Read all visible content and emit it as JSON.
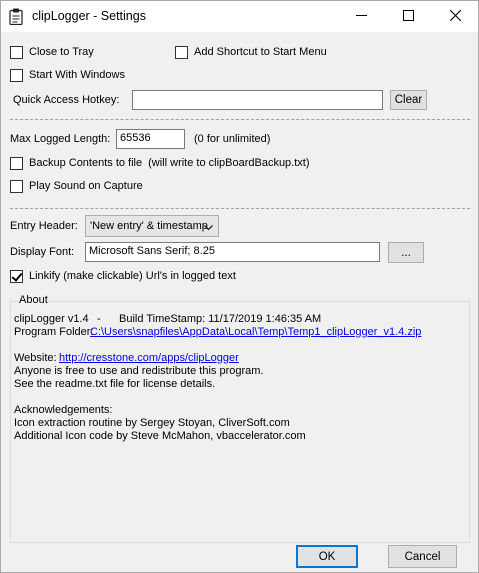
{
  "window": {
    "title": "clipLogger - Settings",
    "icons": [
      "clipboard-icon",
      "minimize-icon",
      "maximize-icon",
      "close-icon"
    ]
  },
  "options": {
    "close_to_tray": {
      "label": "Close to Tray",
      "checked": false
    },
    "add_shortcut": {
      "label": "Add Shortcut to Start Menu",
      "checked": false
    },
    "start_with_windows": {
      "label": "Start With Windows",
      "checked": false
    },
    "hotkey_label": "Quick Access Hotkey:",
    "hotkey_value": "",
    "clear_label": "Clear",
    "max_length_label": "Max Logged Length:",
    "max_length_value": "65536",
    "max_length_hint": "(0 for unlimited)",
    "backup": {
      "label": "Backup Contents to file",
      "hint": "(will write to clipBoardBackup.txt)",
      "checked": false
    },
    "play_sound": {
      "label": "Play Sound on Capture",
      "checked": false
    },
    "entry_header_label": "Entry Header:",
    "entry_header_value": "'New entry' & timestamp",
    "display_font_label": "Display Font:",
    "display_font_value": "Microsoft Sans Serif; 8.25",
    "browse_label": "...",
    "linkify": {
      "label": "Linkify (make clickable) Url's in logged text",
      "checked": true
    }
  },
  "about": {
    "title": "About",
    "version": "clipLogger v1.4",
    "dash": "-",
    "build": "Build TimeStamp: 11/17/2019 1:46:35 AM",
    "folder_label": "Program Folder:",
    "folder_path": "C:\\Users\\snapfiles\\AppData\\Local\\Temp\\Temp1_clipLogger_v1.4.zip",
    "website_label": "Website:",
    "website_url": "http://cresstone.com/apps/clipLogger",
    "free_text": "Anyone is free to use and redistribute this program.",
    "license_text": "See the readme.txt file for license details.",
    "ack_title": "Acknowledgements:",
    "ack_1": "Icon extraction routine by Sergey Stoyan, CliverSoft.com",
    "ack_2": "Additional Icon code by Steve McMahon, vbaccelerator.com"
  },
  "footer": {
    "ok_label": "OK",
    "cancel_label": "Cancel"
  }
}
